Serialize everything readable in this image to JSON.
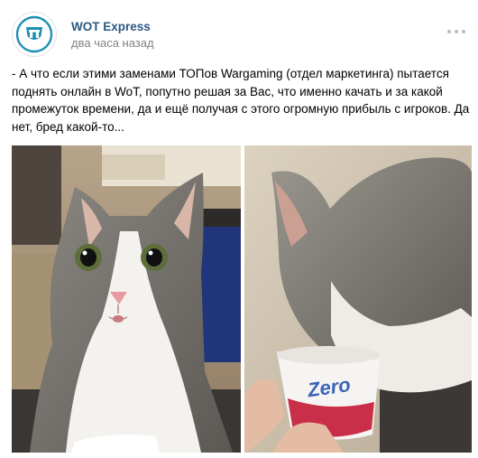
{
  "post": {
    "author": "WOT Express",
    "time": "два часа назад",
    "more_icon": "more-dots-icon",
    "avatar_icon": "wot-tank-shield-logo",
    "text": "- А что если этими заменами ТОПов Wargaming (отдел маркетинга) пытается поднять онлайн в WoT, попутно решая за Вас, что именно качать и за какой промежуток времени, да и ещё получая с этого огромную прибыль с игроков. Да нет, бред какой-то...",
    "photos": [
      {
        "subject": "surprised-cat-photo"
      },
      {
        "subject": "cat-in-yogurt-cup-photo",
        "cup_text": "Zero"
      }
    ]
  },
  "colors": {
    "author": "#2a5885",
    "secondary": "#828282",
    "logo": "#1d8fb4"
  }
}
